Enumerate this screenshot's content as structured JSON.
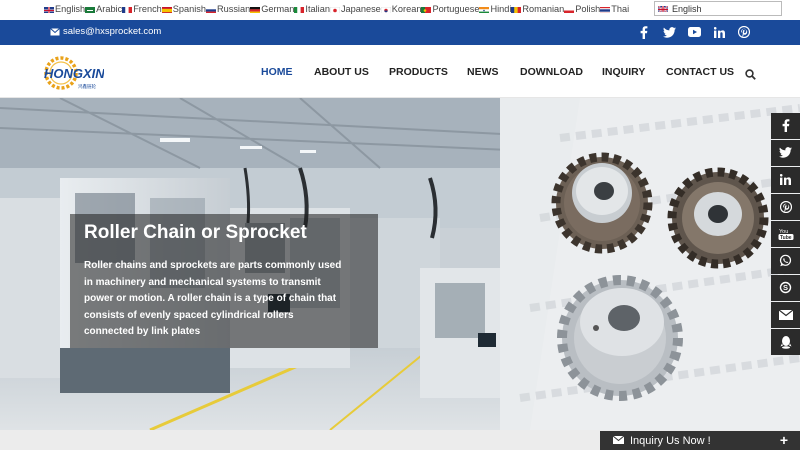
{
  "languages": [
    {
      "label": "English",
      "flag": "gb"
    },
    {
      "label": "Arabic",
      "flag": "sa"
    },
    {
      "label": "French",
      "flag": "fr"
    },
    {
      "label": "Spanish",
      "flag": "es"
    },
    {
      "label": "Russian",
      "flag": "ru"
    },
    {
      "label": "German",
      "flag": "de"
    },
    {
      "label": "Italian",
      "flag": "it"
    },
    {
      "label": "Japanese",
      "flag": "jp"
    },
    {
      "label": "Korean",
      "flag": "kr"
    },
    {
      "label": "Portuguese",
      "flag": "pt"
    },
    {
      "label": "Hindi",
      "flag": "in"
    },
    {
      "label": "Romanian",
      "flag": "ro"
    },
    {
      "label": "Polish",
      "flag": "pl"
    },
    {
      "label": "Thai",
      "flag": "th"
    }
  ],
  "language_select": {
    "value": "English"
  },
  "topbar": {
    "email": "sales@hxsprocket.com",
    "color": "#1a4a9a"
  },
  "social_icons": [
    "facebook-icon",
    "twitter-icon",
    "youtube-icon",
    "linkedin-icon",
    "pinterest-icon"
  ],
  "logo": {
    "text": "HONGXIN"
  },
  "nav": {
    "items": [
      "HOME",
      "ABOUT US",
      "PRODUCTS",
      "NEWS",
      "DOWNLOAD",
      "INQUIRY",
      "CONTACT US"
    ],
    "active": "HOME",
    "accent": "#1a4a9a"
  },
  "hero": {
    "title": "Roller Chain or Sprocket",
    "text": "Roller chains and sprockets are parts commonly used in machinery and mechanical systems to transmit power or motion. A roller chain is a type of chain that consists of evenly spaced cylindrical rollers connected by link plates"
  },
  "share_sidebar": [
    "facebook-icon",
    "twitter-icon",
    "linkedin-icon",
    "pinterest-icon",
    "youtube-icon",
    "whatsapp-icon",
    "skype-icon",
    "email-icon",
    "qq-icon"
  ],
  "inquiry": {
    "label": "Inquiry Us Now !",
    "plus": "+"
  }
}
